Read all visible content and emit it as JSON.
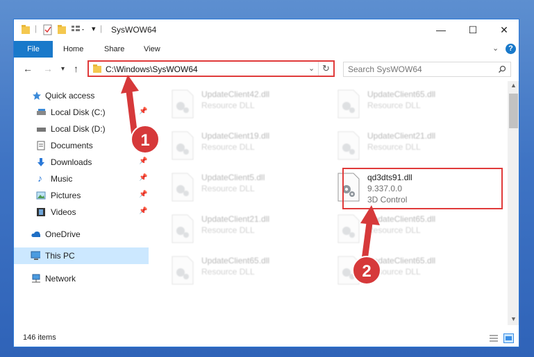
{
  "window": {
    "title": "SysWOW64"
  },
  "ribbon": {
    "tabs": [
      "File",
      "Home",
      "Share",
      "View"
    ]
  },
  "address": {
    "path": "C:\\Windows\\SysWOW64"
  },
  "search": {
    "placeholder": "Search SysWOW64"
  },
  "sidebar": {
    "items": [
      {
        "label": "Quick access"
      },
      {
        "label": "Local Disk (C:)"
      },
      {
        "label": "Local Disk (D:)"
      },
      {
        "label": "Documents"
      },
      {
        "label": "Downloads"
      },
      {
        "label": "Music"
      },
      {
        "label": "Pictures"
      },
      {
        "label": "Videos"
      },
      {
        "label": "OneDrive"
      },
      {
        "label": "This PC"
      },
      {
        "label": "Network"
      }
    ]
  },
  "files": [
    {
      "name": "UpdateClient42.dll",
      "type": "Resource DLL"
    },
    {
      "name": "UpdateClient65.dll",
      "type": "Resource DLL"
    },
    {
      "name": "UpdateClient19.dll",
      "type": "Resource DLL"
    },
    {
      "name": "UpdateClient21.dll",
      "type": "Resource DLL"
    },
    {
      "name": "UpdateClient5.dll",
      "type": "Resource DLL"
    },
    {
      "name": "qd3dts91.dll",
      "version": "9.337.0.0",
      "type": "3D Control"
    },
    {
      "name": "UpdateClient21.dll",
      "type": "Resource DLL"
    },
    {
      "name": "UpdateClient65.dll",
      "type": "Resource DLL"
    },
    {
      "name": "UpdateClient65.dll",
      "type": "Resource DLL"
    },
    {
      "name": "UpdateClient65.dll",
      "type": "Resource DLL"
    }
  ],
  "status": {
    "item_count": "146 items"
  },
  "markers": {
    "one": "1",
    "two": "2"
  },
  "colors": {
    "accent": "#1979ca",
    "annotation": "#e03a3a",
    "selected": "#cce8ff"
  }
}
